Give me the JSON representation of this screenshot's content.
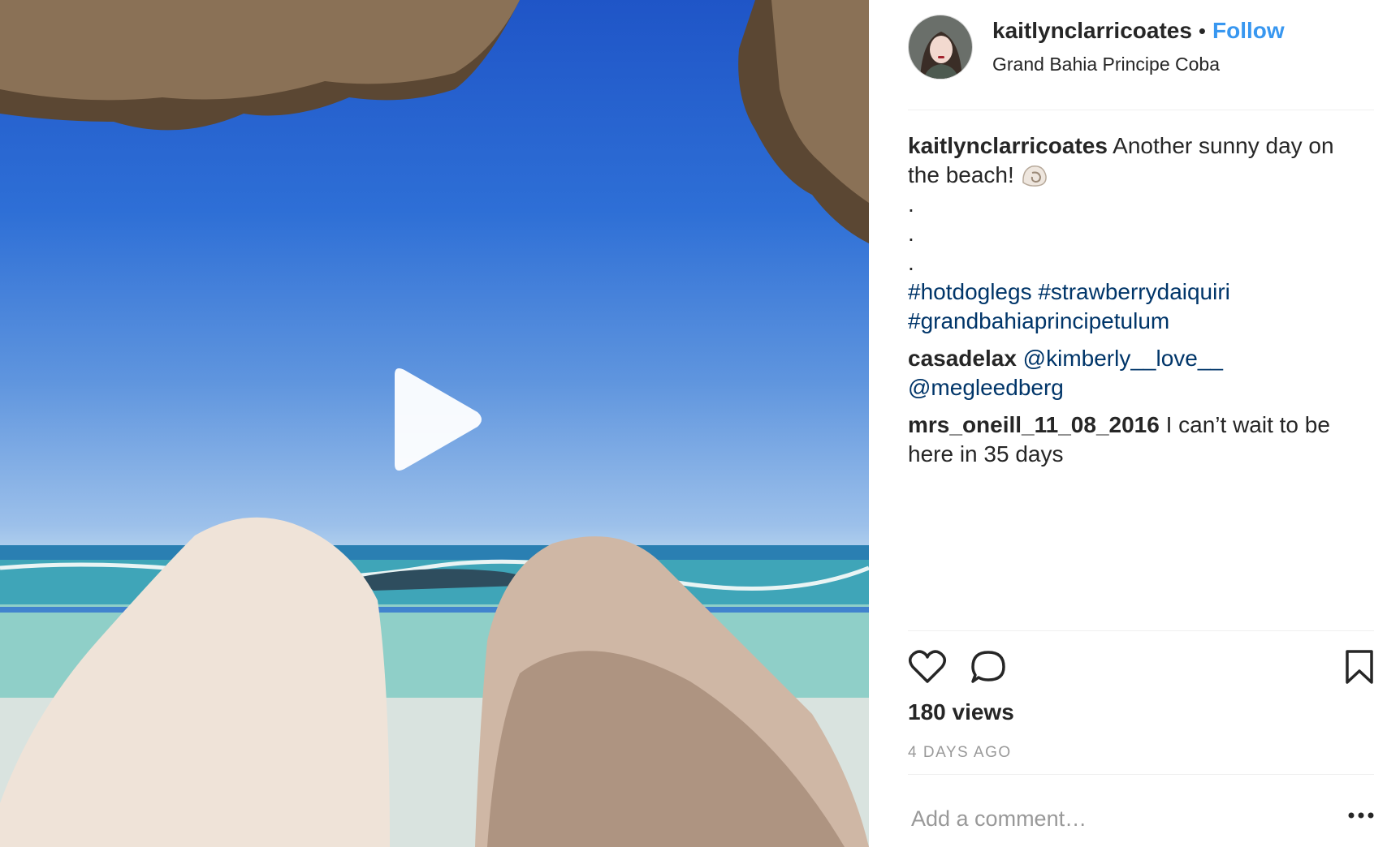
{
  "post": {
    "username": "kaitlynclarricoates",
    "separator": "•",
    "follow_label": "Follow",
    "location": "Grand Bahia Principe Coba",
    "play_icon": "play-icon"
  },
  "caption": {
    "username": "kaitlynclarricoates",
    "text": "Another sunny day on the beach!",
    "emoji_icon": "spiral-shell-icon",
    "dots": [
      ".",
      ".",
      "."
    ],
    "hashtags": [
      "#hotdoglegs",
      "#strawberrydaiquiri",
      "#grandbahiaprincipetulum"
    ]
  },
  "comments": [
    {
      "username": "casadelax",
      "mentions": [
        "@kimberly__love__",
        "@megleedberg"
      ]
    },
    {
      "username": "mrs_oneill_11_08_2016",
      "text": "I can’t wait to be here in 35 days"
    }
  ],
  "engagement": {
    "views": "180 views",
    "time_ago": "4 DAYS AGO",
    "like_icon": "heart-icon",
    "comment_icon": "comment-icon",
    "save_icon": "bookmark-icon"
  },
  "add_comment": {
    "placeholder": "Add a comment…",
    "more_icon": "more-options-icon"
  },
  "colors": {
    "link_blue": "#3897f0",
    "hashtag": "#003569",
    "text": "#262626",
    "muted": "#999999"
  }
}
